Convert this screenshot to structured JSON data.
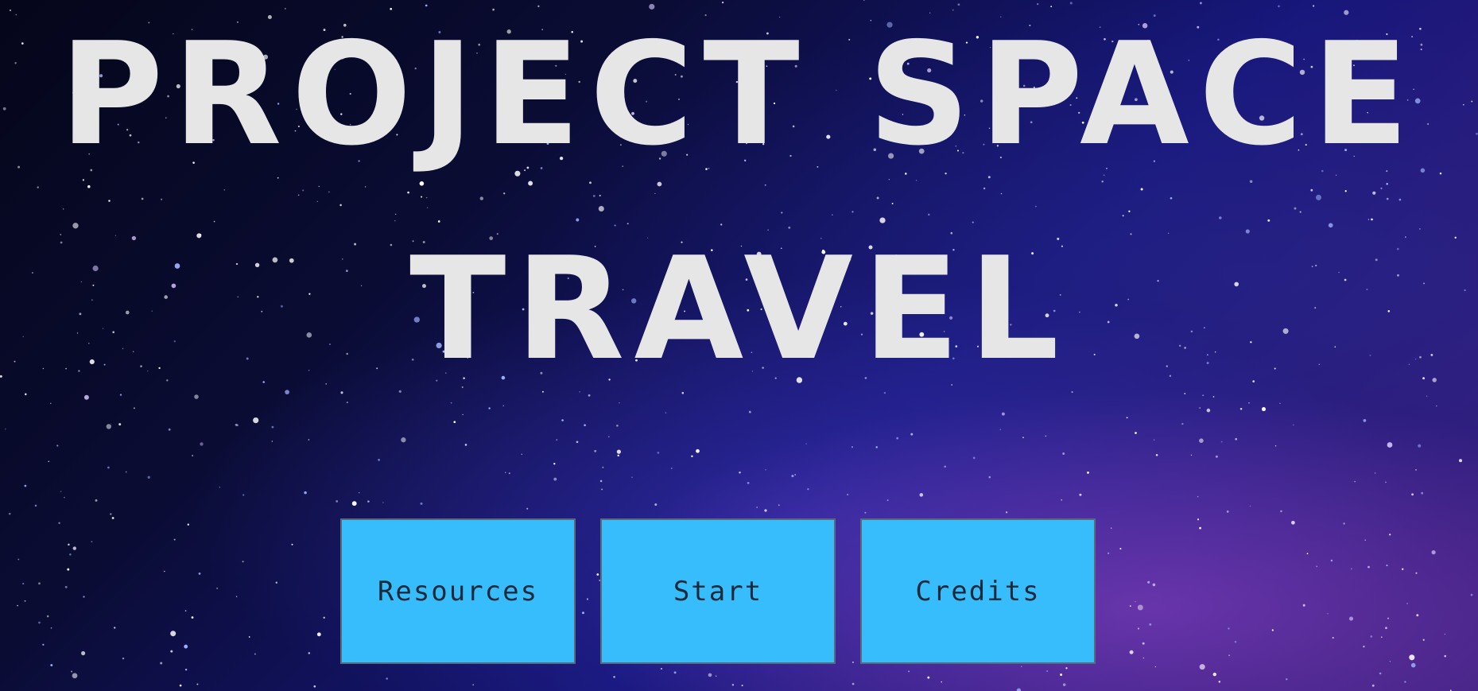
{
  "title": {
    "line1": "PROJECT SPACE",
    "line2": "TRAVEL"
  },
  "menu": {
    "buttons": [
      {
        "label": "Resources"
      },
      {
        "label": "Start"
      },
      {
        "label": "Credits"
      }
    ]
  },
  "colors": {
    "button_bg": "#38bdfc",
    "title_text": "#e6e6e6",
    "button_text": "#1b2a3a"
  },
  "background": {
    "icon": "starfield-image"
  }
}
